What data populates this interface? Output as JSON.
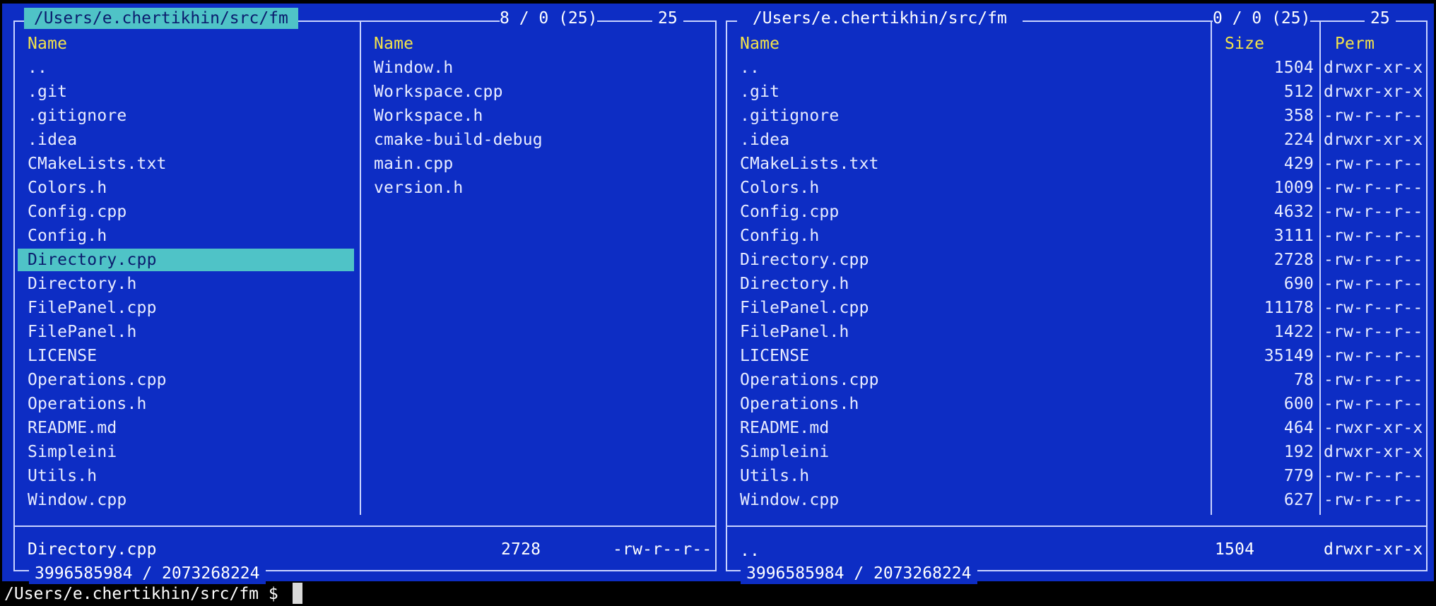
{
  "left_panel": {
    "title": " /Users/e.chertikhin/src/fm ",
    "selection_info": "8 / 0 (25)",
    "total": "25",
    "col1_header": "Name",
    "col2_header": "Name",
    "col1_items": [
      "..",
      ".git",
      ".gitignore",
      ".idea",
      "CMakeLists.txt",
      "Colors.h",
      "Config.cpp",
      "Config.h",
      "Directory.cpp",
      "Directory.h",
      "FilePanel.cpp",
      "FilePanel.h",
      "LICENSE",
      "Operations.cpp",
      "Operations.h",
      "README.md",
      "Simpleini",
      "Utils.h",
      "Window.cpp"
    ],
    "col2_items": [
      "Window.h",
      "Workspace.cpp",
      "Workspace.h",
      "cmake-build-debug",
      "main.cpp",
      "version.h"
    ],
    "selected_item": "Directory.cpp",
    "status": {
      "name": "Directory.cpp",
      "size": "2728",
      "perm": "-rw-r--r--"
    },
    "disk_info": "3996585984 / 2073268224"
  },
  "right_panel": {
    "title": " /Users/e.chertikhin/src/fm ",
    "selection_info": "0 / 0 (25)",
    "total": "25",
    "headers": {
      "name": "Name",
      "size": "Size",
      "perm": "Perm"
    },
    "rows": [
      {
        "name": "..",
        "size": "1504",
        "perm": "drwxr-xr-x"
      },
      {
        "name": ".git",
        "size": "512",
        "perm": "drwxr-xr-x"
      },
      {
        "name": ".gitignore",
        "size": "358",
        "perm": "-rw-r--r--"
      },
      {
        "name": ".idea",
        "size": "224",
        "perm": "drwxr-xr-x"
      },
      {
        "name": "CMakeLists.txt",
        "size": "429",
        "perm": "-rw-r--r--"
      },
      {
        "name": "Colors.h",
        "size": "1009",
        "perm": "-rw-r--r--"
      },
      {
        "name": "Config.cpp",
        "size": "4632",
        "perm": "-rw-r--r--"
      },
      {
        "name": "Config.h",
        "size": "3111",
        "perm": "-rw-r--r--"
      },
      {
        "name": "Directory.cpp",
        "size": "2728",
        "perm": "-rw-r--r--"
      },
      {
        "name": "Directory.h",
        "size": "690",
        "perm": "-rw-r--r--"
      },
      {
        "name": "FilePanel.cpp",
        "size": "11178",
        "perm": "-rw-r--r--"
      },
      {
        "name": "FilePanel.h",
        "size": "1422",
        "perm": "-rw-r--r--"
      },
      {
        "name": "LICENSE",
        "size": "35149",
        "perm": "-rw-r--r--"
      },
      {
        "name": "Operations.cpp",
        "size": "78",
        "perm": "-rw-r--r--"
      },
      {
        "name": "Operations.h",
        "size": "600",
        "perm": "-rw-r--r--"
      },
      {
        "name": "README.md",
        "size": "464",
        "perm": "-rwxr-xr-x"
      },
      {
        "name": "Simpleini",
        "size": "192",
        "perm": "drwxr-xr-x"
      },
      {
        "name": "Utils.h",
        "size": "779",
        "perm": "-rw-r--r--"
      },
      {
        "name": "Window.cpp",
        "size": "627",
        "perm": "-rw-r--r--"
      }
    ],
    "status": {
      "name": "..",
      "size": "1504",
      "perm": "drwxr-xr-x"
    },
    "disk_info": "3996585984 / 2073268224"
  },
  "prompt": "/Users/e.chertikhin/src/fm $ ",
  "colors": {
    "background": "#0d2dc4",
    "highlight": "#4fc3c7",
    "header": "#f3e34a",
    "border": "#c9d3ff"
  }
}
